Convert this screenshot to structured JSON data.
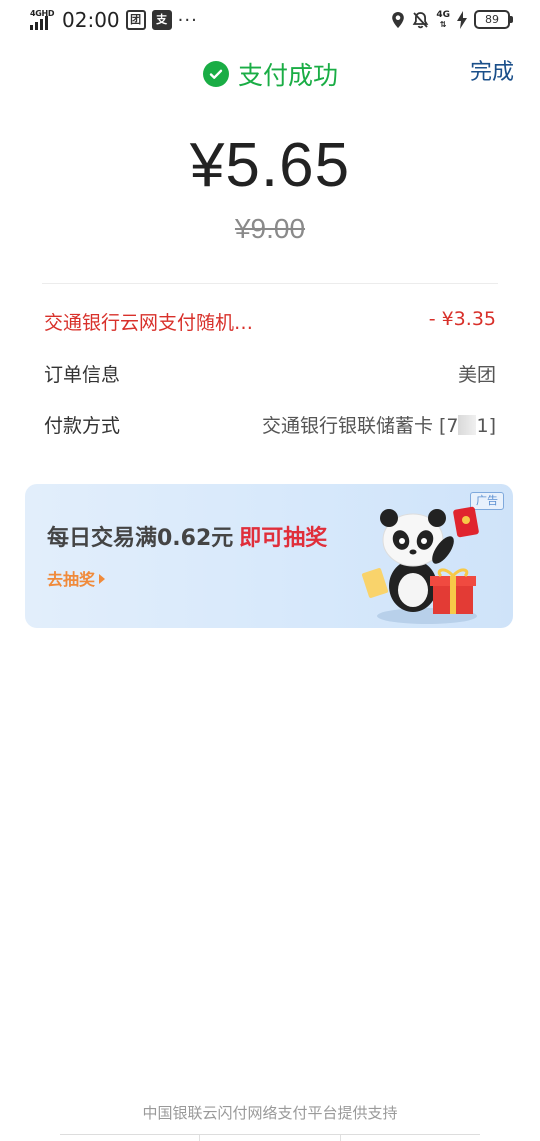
{
  "status_bar": {
    "network": "4GHD",
    "time": "02:00",
    "app_icon_1": "团",
    "app_icon_2": "支",
    "more": "···",
    "network_right": "4G",
    "battery": "89"
  },
  "header": {
    "status_text": "支付成功",
    "done_label": "完成"
  },
  "payment": {
    "amount": "¥5.65",
    "original_amount": "¥9.00"
  },
  "details": {
    "discount_label": "交通银行云网支付随机…",
    "discount_value": "- ¥3.35",
    "order_label": "订单信息",
    "order_value": "美团",
    "method_label": "付款方式",
    "method_value_prefix": "交通银行银联储蓄卡 [7",
    "method_value_suffix": "1]"
  },
  "ad": {
    "tag": "广告",
    "title_main": "每日交易满0.62元",
    "title_highlight": "即可抽奖",
    "cta": "去抽奖"
  },
  "footer": {
    "text": "中国银联云闪付网络支付平台提供支持"
  },
  "colors": {
    "success_green": "#1aad45",
    "discount_red": "#d8302a",
    "link_blue": "#1a4f8a",
    "ad_red": "#e02e3a",
    "ad_orange": "#f08a3a"
  },
  "icons": [
    "signal-icon",
    "location-icon",
    "mute-bell-icon",
    "charging-icon",
    "battery-icon",
    "check-circle-icon",
    "panda-mascot-illustration"
  ]
}
